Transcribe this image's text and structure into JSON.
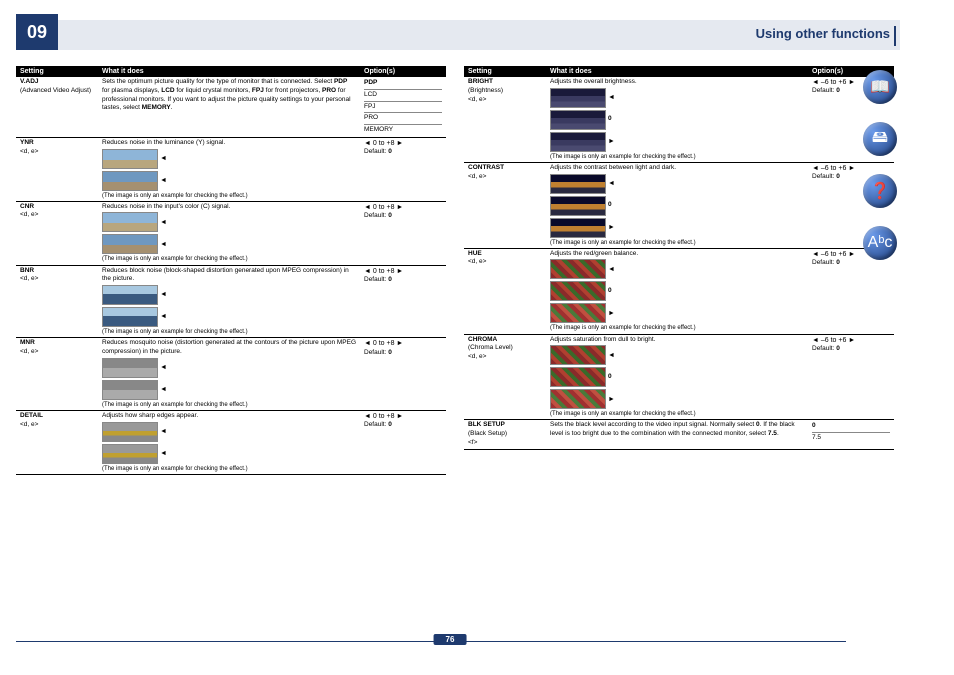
{
  "chapter": "09",
  "page_title": "Using other functions",
  "page_number": "76",
  "headers": {
    "setting": "Setting",
    "what": "What it does",
    "options": "Option(s)"
  },
  "common": {
    "image_note": "(The image is only an example for checking the effect.)",
    "default_label": "Default:",
    "range_0_8": "◄ 0 to +8 ►",
    "range_m6_6": "◄ –6 to +6 ►",
    "zero": "0",
    "tri_left": "◄",
    "tri_right": "►"
  },
  "left": [
    {
      "name": "V.ADJ",
      "sub": "(Advanced Video Adjust)",
      "desc_html": "Sets the optimum picture quality for the type of monitor that is connected. Select <b>PDP</b> for plasma displays, <b>LCD</b> for liquid crystal monitors, <b>FPJ</b> for front projectors, <b>PRO</b> for professional monitors. If you want to adjust the picture quality settings to your personal tastes, select <b>MEMORY</b>.",
      "options_list": [
        "PDP",
        "LCD",
        "FPJ",
        "PRO",
        "MEMORY"
      ],
      "options_bold_idx": 0,
      "thumbs": false
    },
    {
      "name": "YNR",
      "sub": "<d, e>",
      "desc": "Reduces noise in the luminance (Y) signal.",
      "range": "range_0_8",
      "default": "0",
      "thumbs": [
        "sky",
        "sky2"
      ]
    },
    {
      "name": "CNR",
      "sub": "<d, e>",
      "desc": "Reduces noise in the input's color (C) signal.",
      "range": "range_0_8",
      "default": "0",
      "thumbs": [
        "sky",
        "sky2"
      ]
    },
    {
      "name": "BNR",
      "sub": "<d, e>",
      "desc": "Reduces block noise (block-shaped distortion generated upon MPEG compression) in the picture.",
      "range": "range_0_8",
      "default": "0",
      "thumbs": [
        "river",
        "river"
      ]
    },
    {
      "name": "MNR",
      "sub": "<d, e>",
      "desc": "Reduces mosquito noise (distortion generated at the contours of the picture upon MPEG compression) in the picture.",
      "range": "range_0_8",
      "default": "0",
      "thumbs": [
        "gray",
        "gray"
      ]
    },
    {
      "name": "DETAIL",
      "sub": "<d, e>",
      "desc": "Adjusts how sharp edges appear.",
      "range": "range_0_8",
      "default": "0",
      "thumbs": [
        "flower",
        "flower"
      ]
    }
  ],
  "right": [
    {
      "name": "BRIGHT",
      "sub": "(Brightness)\n<d, e>",
      "desc": "Adjusts the overall brightness.",
      "range": "range_m6_6",
      "default": "0",
      "thumbs": [
        "night",
        "night"
      ],
      "mid_label": "0"
    },
    {
      "name": "CONTRAST",
      "sub": "<d, e>",
      "desc": "Adjusts the contrast between light and dark.",
      "range": "range_m6_6",
      "default": "0",
      "thumbs": [
        "night2",
        "night2"
      ],
      "mid_label": "0"
    },
    {
      "name": "HUE",
      "sub": "<d, e>",
      "desc": "Adjusts the red/green balance.",
      "range": "range_m6_6",
      "default": "0",
      "thumbs": [
        "fruit",
        "fruit2"
      ],
      "mid_label": "0"
    },
    {
      "name": "CHROMA",
      "sub": "(Chroma Level)\n<d, e>",
      "desc": "Adjusts saturation from dull to bright.",
      "range": "range_m6_6",
      "default": "0",
      "thumbs": [
        "fruit",
        "fruit2"
      ],
      "mid_label": "0"
    },
    {
      "name": "BLK SETUP",
      "sub": "(Black Setup)\n<f>",
      "desc_html": "Sets the black level according to the video input signal. Normally select <b>0</b>. If the black level is too bright due to the combination with the connected monitor, select <b>7.5</b>.",
      "options_list": [
        "0",
        "7.5"
      ],
      "options_bold_idx": 0,
      "thumbs": false
    }
  ],
  "side_icons": [
    "book-icon",
    "drive-icon",
    "help-icon",
    "abc-icon"
  ],
  "side_glyphs": [
    "📖",
    "🖴",
    "❓",
    "Aᵇc"
  ]
}
